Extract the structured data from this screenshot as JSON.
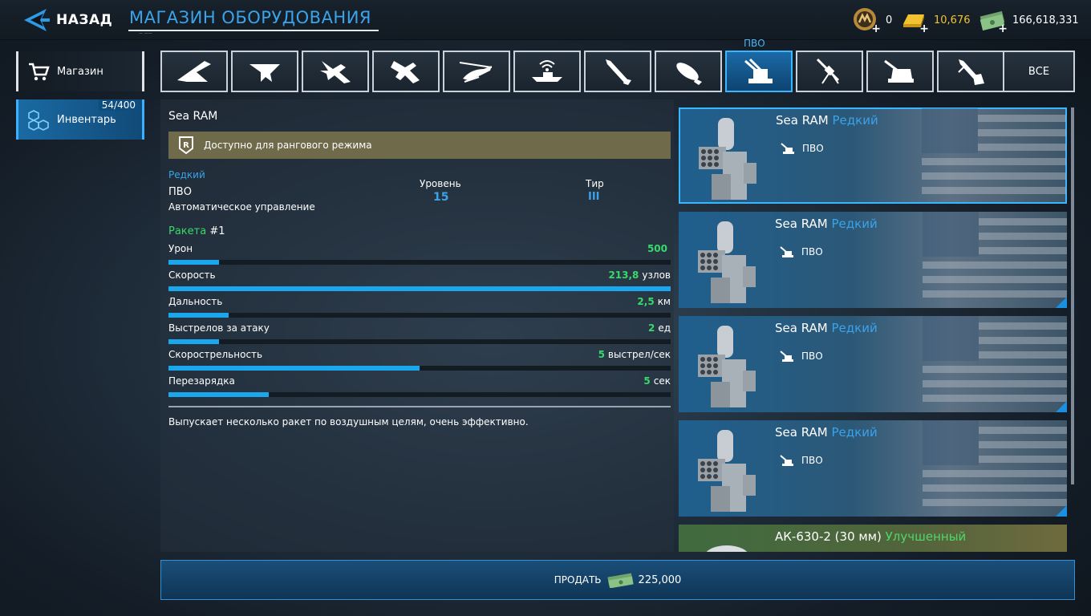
{
  "header": {
    "back_label": "НАЗАД",
    "title": "МАГАЗИН ОБОРУДОВАНИЯ",
    "title_sub": "—  ——"
  },
  "currencies": [
    {
      "icon": "medal-icon",
      "value": "0",
      "color": "#ffffff"
    },
    {
      "icon": "gold-bar-icon",
      "value": "10,676",
      "color": "#f2c230"
    },
    {
      "icon": "cash-icon",
      "value": "166,618,331",
      "color": "#ffffff"
    }
  ],
  "sidebar": {
    "shop_label": "Магазин",
    "inventory_label": "Инвентарь",
    "inventory_count": "54/400"
  },
  "tabs": {
    "active_caption": "ПВО",
    "all_label": "ВСЕ",
    "icons": [
      "stealth-bomber-icon",
      "flying-wing-icon",
      "fighter-jet-icon",
      "interceptor-jet-icon",
      "helicopter-icon",
      "radar-boat-icon",
      "missile-icon",
      "bomb-icon",
      "aa-turret-icon",
      "machine-gun-icon",
      "naval-gun-icon",
      "rocket-icon"
    ]
  },
  "detail": {
    "name": "Sea RAM",
    "ranked_text": "Доступно для рангового режима",
    "rarity": "Редкий",
    "type": "ПВО",
    "control": "Автоматическое управление",
    "level_label": "Уровень",
    "level_value": "15",
    "tier_label": "Тир",
    "tier_value": "III",
    "weapon_label": "Ракета",
    "weapon_num": "#1",
    "stats": [
      {
        "name": "Урон",
        "value": "500",
        "unit": "",
        "fill": 0.1
      },
      {
        "name": "Скорость",
        "value": "213,8",
        "unit": "узлов",
        "fill": 1.0
      },
      {
        "name": "Дальность",
        "value": "2,5",
        "unit": "км",
        "fill": 0.12
      },
      {
        "name": "Выстрелов за атаку",
        "value": "2",
        "unit": "ед",
        "fill": 0.1
      },
      {
        "name": "Скорострельность",
        "value": "5",
        "unit": "выстрел/сек",
        "fill": 0.5
      },
      {
        "name": "Перезарядка",
        "value": "5",
        "unit": "сек",
        "fill": 0.2
      }
    ],
    "description": "Выпускает несколько ракет по воздушным целям, очень эффективно."
  },
  "items": [
    {
      "name": "Sea RAM",
      "rarity": "Редкий",
      "type": "ПВО"
    },
    {
      "name": "Sea RAM",
      "rarity": "Редкий",
      "type": "ПВО"
    },
    {
      "name": "Sea RAM",
      "rarity": "Редкий",
      "type": "ПВО"
    },
    {
      "name": "Sea RAM",
      "rarity": "Редкий",
      "type": "ПВО"
    }
  ],
  "partial_item": {
    "name": "АК-630-2 (30 мм)",
    "rarity": "Улучшенный"
  },
  "sell": {
    "label": "ПРОДАТЬ",
    "price": "225,000"
  }
}
